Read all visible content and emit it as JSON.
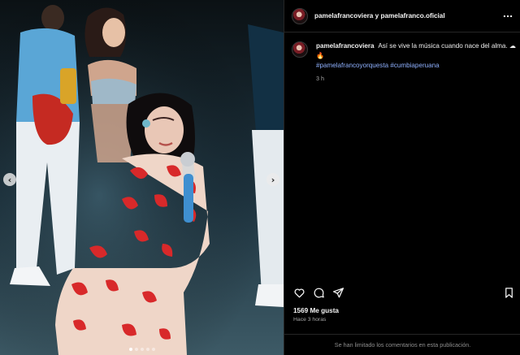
{
  "header": {
    "title": "pamelafrancoviera y pamelafranco.oficial",
    "more_icon": "more-horizontal-icon"
  },
  "media": {
    "prev_label": "‹",
    "next_label": "›",
    "slide_count": 5,
    "active_slide": 1
  },
  "caption": {
    "username": "pamelafrancoviera",
    "text": "Así se vive la música cuando nace del alma. ☁",
    "emoji": "🔥",
    "hashtags": [
      "#pamelafrancoyorquesta",
      "#cumbiaperuana"
    ],
    "time": "3 h"
  },
  "actions": {
    "like_icon": "heart-icon",
    "comment_icon": "comment-icon",
    "share_icon": "send-icon",
    "save_icon": "bookmark-icon"
  },
  "likes": "1569 Me gusta",
  "posted": "Hace 3 horas",
  "footer": "Se han limitado los comentarios en esta publicación.",
  "colors": {
    "background": "#000000",
    "hashtag": "#8fb1ff",
    "muted": "#a8a8a8"
  }
}
